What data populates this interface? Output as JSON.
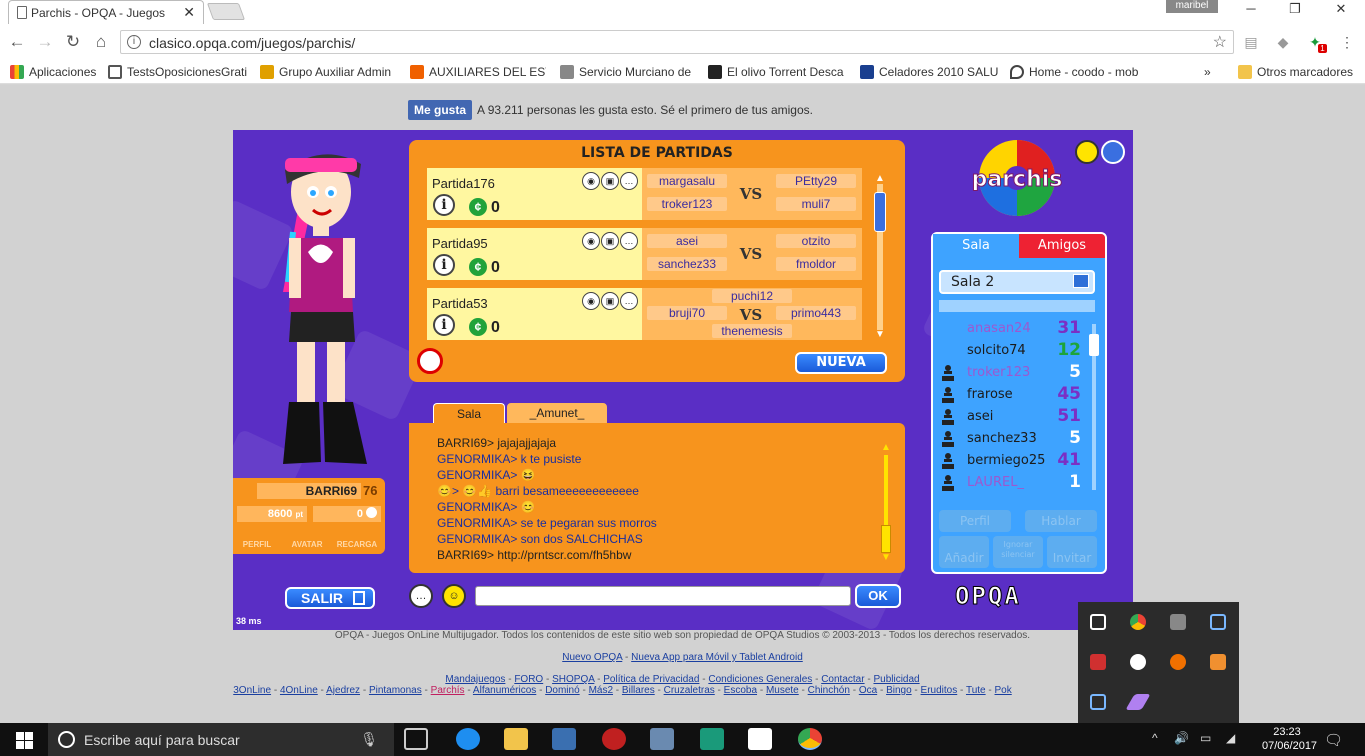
{
  "browser": {
    "tab_title": "Parchis - OPQA - Juegos",
    "tab_close": "✕",
    "profile_name": "maribel",
    "url": "clasico.opqa.com/juegos/parchis/",
    "extension_badge": "1"
  },
  "bookmarks": [
    {
      "label": "Aplicaciones",
      "color": "#4285f4"
    },
    {
      "label": "TestsOposicionesGrati",
      "color": "#555555"
    },
    {
      "label": "Grupo Auxiliar Admin",
      "color": "#e0a000"
    },
    {
      "label": "AUXILIARES DEL ESTA",
      "color": "#f06000"
    },
    {
      "label": "Servicio Murciano de",
      "color": "#888888"
    },
    {
      "label": "El olivo Torrent Desca",
      "color": "#222222"
    },
    {
      "label": "Celadores 2010 SALU",
      "color": "#1a3f8f"
    },
    {
      "label": "Home - coodo - mob",
      "color": "#444444"
    }
  ],
  "bookmarks_more": "»",
  "bookmarks_other": "Otros marcadores",
  "fb": {
    "button": "Me gusta",
    "text": "A 93.211 personas les gusta esto. Sé el primero de tus amigos."
  },
  "player": {
    "name": "BARRI69",
    "level": "76",
    "points": "8600",
    "points_unit": "pt",
    "coins": "0",
    "buttons": [
      "PERFIL",
      "AVATAR",
      "RECARGA"
    ],
    "exit_label": "SALIR",
    "latency": "38 ms"
  },
  "games": {
    "title": "LISTA DE PARTIDAS",
    "new_label": "NUEVA",
    "vs_label": "VS",
    "rows": [
      {
        "name": "Partida176",
        "bet": "0",
        "left_top": "margasalu",
        "left_bottom": "troker123",
        "right_top": "PEtty29",
        "right_bottom": "muli7"
      },
      {
        "name": "Partida95",
        "bet": "0",
        "left_top": "asei",
        "left_bottom": "sanchez33",
        "right_top": "otzito",
        "right_bottom": "fmoldor"
      },
      {
        "name": "Partida53",
        "bet": "0",
        "top": "puchi12",
        "left": "bruji70",
        "right": "primo443",
        "bottom": "thenemesis"
      }
    ]
  },
  "chat": {
    "tabs": [
      "Sala",
      "_Amunet_"
    ],
    "lines": [
      {
        "text": "BARRI69> jajajajjajaja",
        "color": "#222222"
      },
      {
        "text": "GENORMIKA> k te pusiste",
        "color": "#1a2ea0"
      },
      {
        "text": "GENORMIKA> 😆",
        "color": "#1a2ea0"
      },
      {
        "text": "😊> 😊👍  barri besameeeeeeeeeeee",
        "color": "#1a2ea0"
      },
      {
        "text": "GENORMIKA> 😊",
        "color": "#1a2ea0"
      },
      {
        "text": "GENORMIKA> se te pegaran sus morros",
        "color": "#1a2ea0"
      },
      {
        "text": "GENORMIKA> son dos SALCHICHAS",
        "color": "#1a2ea0"
      },
      {
        "text": "BARRI69> http://prntscr.com/fh5hbw",
        "color": "#222222"
      }
    ],
    "input_value": "",
    "ok_label": "OK"
  },
  "room": {
    "logo_text": "parchis",
    "tab_room": "Sala",
    "tab_friends": "Amigos",
    "current": "Sala 2",
    "users": [
      {
        "name": "anasan24",
        "level": "31",
        "name_color": "#9b59d0",
        "level_color": "#7b2fc4",
        "icon": false
      },
      {
        "name": "solcito74",
        "level": "12",
        "name_color": "#1b1b1b",
        "level_color": "#1ea43a",
        "icon": false
      },
      {
        "name": "troker123",
        "level": "5",
        "name_color": "#9b59d0",
        "level_color": "#ffffff",
        "icon": true
      },
      {
        "name": "frarose",
        "level": "45",
        "name_color": "#1b1b1b",
        "level_color": "#7b2fc4",
        "icon": true
      },
      {
        "name": "asei",
        "level": "51",
        "name_color": "#1b1b1b",
        "level_color": "#7b2fc4",
        "icon": true
      },
      {
        "name": "sanchez33",
        "level": "5",
        "name_color": "#1b1b1b",
        "level_color": "#ffffff",
        "icon": true
      },
      {
        "name": "bermiego25",
        "level": "41",
        "name_color": "#1b1b1b",
        "level_color": "#7b2fc4",
        "icon": true
      },
      {
        "name": "LAUREL_",
        "level": "1",
        "name_color": "#9b59d0",
        "level_color": "#ffffff",
        "icon": true
      }
    ],
    "buttons": {
      "profile": "Perfil",
      "talk": "Hablar",
      "add": "Añadir",
      "ignore": "Ignorar silenciar",
      "invite": "Invitar"
    },
    "brand": "OPQA"
  },
  "footer": {
    "copyright": "OPQA - Juegos OnLine Multijugador. Todos los contenidos de este sitio web son propiedad de OPQA Studios © 2003-2013 - Todos los derechos reservados.",
    "promo": [
      "Nuevo OPQA",
      "Nueva App para Móvil y Tablet Android"
    ],
    "links": [
      "Mandajuegos",
      "FORO",
      "SHOPQA",
      "Política de Privacidad",
      "Condiciones Generales",
      "Contactar",
      "Publicidad"
    ],
    "games": [
      "3OnLine",
      "4OnLine",
      "Ajedrez",
      "Pintamonas",
      "Parchís",
      "Alfanuméricos",
      "Dominó",
      "Más2",
      "Billares",
      "Cruzaletras",
      "Escoba",
      "Musete",
      "Chinchón",
      "Oca",
      "Bingo",
      "Eruditos",
      "Tute",
      "Pok"
    ]
  },
  "taskbar": {
    "search_placeholder": "Escribe aquí para buscar",
    "time": "23:23",
    "date": "07/06/2017"
  },
  "colors": {
    "game_bg": "#5a2ec5",
    "panel_orange": "#f7941d",
    "row_yellow": "#fff7a0",
    "room_blue": "#3ea3ff",
    "friends_red": "#ee2233"
  }
}
